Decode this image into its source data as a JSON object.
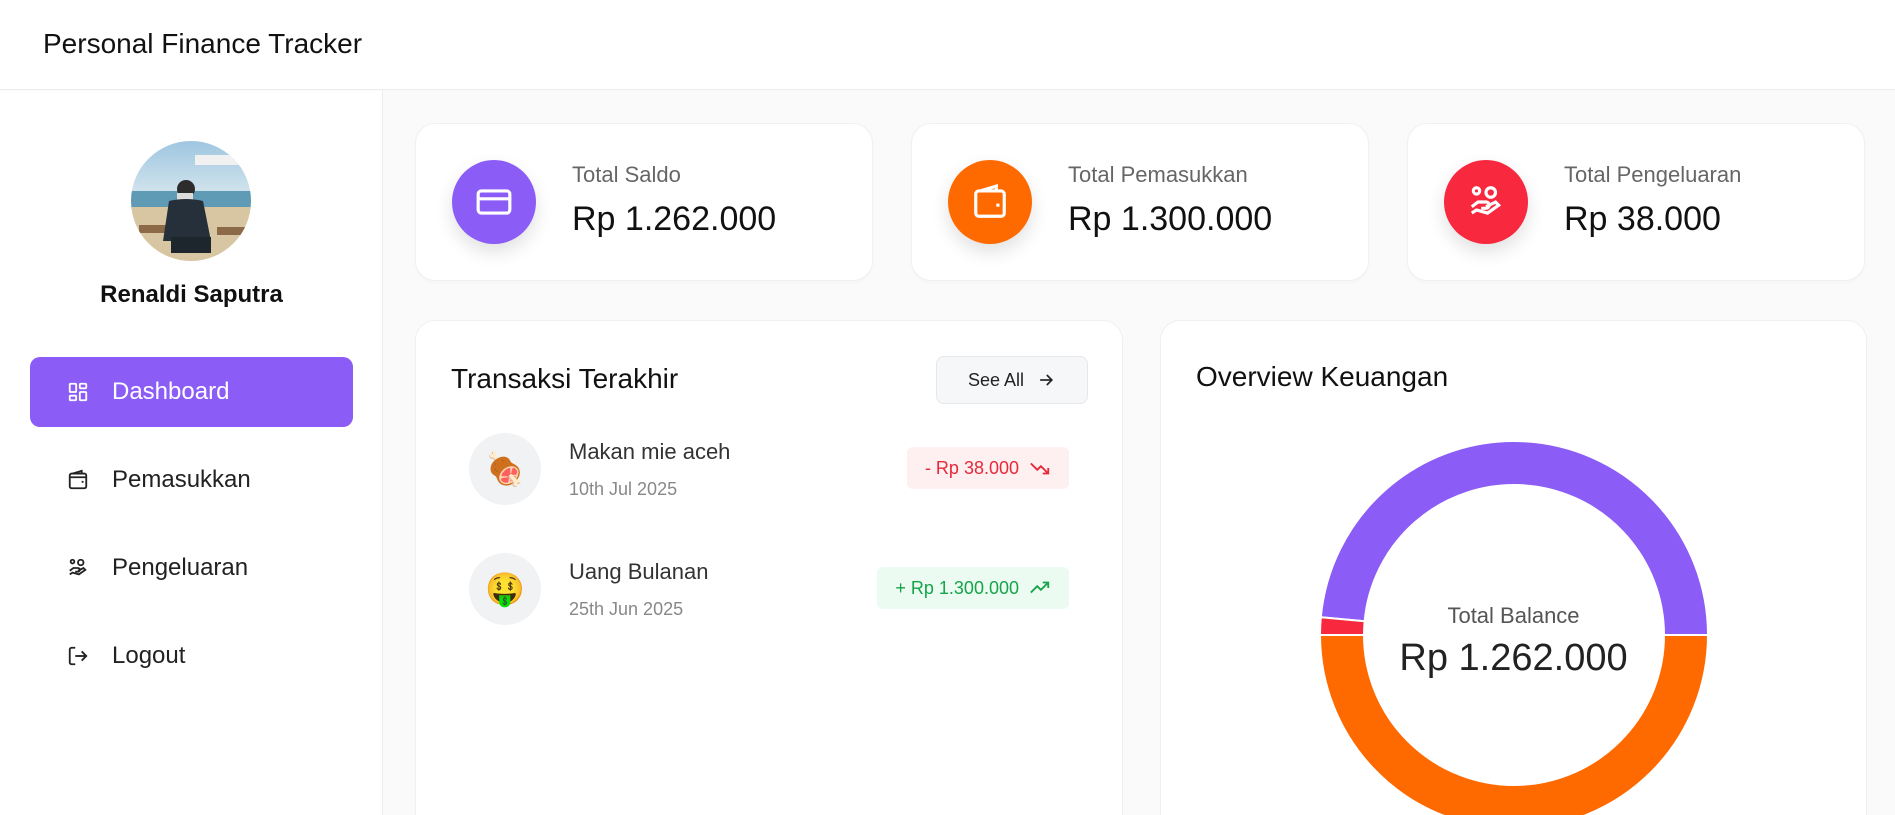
{
  "app": {
    "title": "Personal Finance Tracker"
  },
  "user": {
    "name": "Renaldi Saputra"
  },
  "sidebar": {
    "items": [
      {
        "label": "Dashboard",
        "icon": "dashboard-icon",
        "active": true
      },
      {
        "label": "Pemasukkan",
        "icon": "wallet-icon",
        "active": false
      },
      {
        "label": "Pengeluaran",
        "icon": "hand-coins-icon",
        "active": false
      },
      {
        "label": "Logout",
        "icon": "logout-icon",
        "active": false
      }
    ]
  },
  "stats": [
    {
      "label": "Total Saldo",
      "value": "Rp 1.262.000",
      "icon": "credit-card-icon",
      "color": "#8b5cf6"
    },
    {
      "label": "Total Pemasukkan",
      "value": "Rp 1.300.000",
      "icon": "wallet-icon",
      "color": "#ff6a00"
    },
    {
      "label": "Total Pengeluaran",
      "value": "Rp 38.000",
      "icon": "hand-coins-icon",
      "color": "#f8283e"
    }
  ],
  "transactions": {
    "title": "Transaksi Terakhir",
    "see_all_label": "See All",
    "items": [
      {
        "name": "Makan mie aceh",
        "date": "10th Jul 2025",
        "amount": "- Rp 38.000",
        "type": "expense",
        "emoji": "🍖"
      },
      {
        "name": "Uang Bulanan",
        "date": "25th Jun 2025",
        "amount": "+ Rp 1.300.000",
        "type": "income",
        "emoji": "🤑"
      }
    ]
  },
  "overview": {
    "title": "Overview Keuangan",
    "center_label": "Total Balance",
    "center_value": "Rp 1.262.000"
  },
  "chart_data": {
    "type": "pie",
    "donut": true,
    "categories": [
      "Total Saldo",
      "Total Pengeluaran",
      "Total Pemasukkan"
    ],
    "values": [
      1262000,
      38000,
      1300000
    ],
    "colors": [
      "#8b5cf6",
      "#f8283e",
      "#ff6a00"
    ]
  }
}
